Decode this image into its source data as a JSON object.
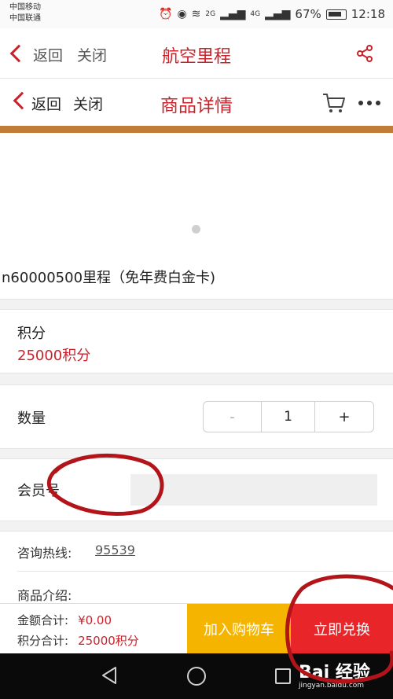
{
  "status_bar": {
    "carrier_1": "中国移动",
    "carrier_2": "中国联通",
    "signal_1_label": "2G",
    "signal_2_label": "4G",
    "battery": "67%",
    "time": "12:18"
  },
  "nav_outer": {
    "back_label": "返回",
    "close_label": "关闭",
    "title": "航空里程"
  },
  "nav_inner": {
    "back_label": "返回",
    "close_label": "关闭",
    "title": "商品详情"
  },
  "product": {
    "name": "n60000500里程（免年费白金卡)"
  },
  "points_section": {
    "label": "积分",
    "value": "25000积分"
  },
  "quantity_section": {
    "label": "数量",
    "minus": "-",
    "quantity": "1",
    "plus": "+"
  },
  "member_section": {
    "label": "会员号",
    "input_value": ""
  },
  "info": {
    "hotline_label": "咨询热线:",
    "hotline_number": "95539",
    "intro_label": "商品介绍:"
  },
  "bottom_bar": {
    "amount_label": "金额合计:",
    "amount_value": "¥0.00",
    "points_label": "积分合计:",
    "points_value": "25000积分",
    "add_to_cart": "加入购物车",
    "redeem_now": "立即兑换"
  },
  "watermark": {
    "brand": "Bai 经验",
    "url": "jingyan.baidu.com"
  },
  "colors": {
    "brand_red": "#c8232c",
    "accent_bar": "#c27c3a",
    "cart_button": "#f4b400",
    "redeem_button": "#e8262a",
    "annotation": "#b3141a"
  }
}
